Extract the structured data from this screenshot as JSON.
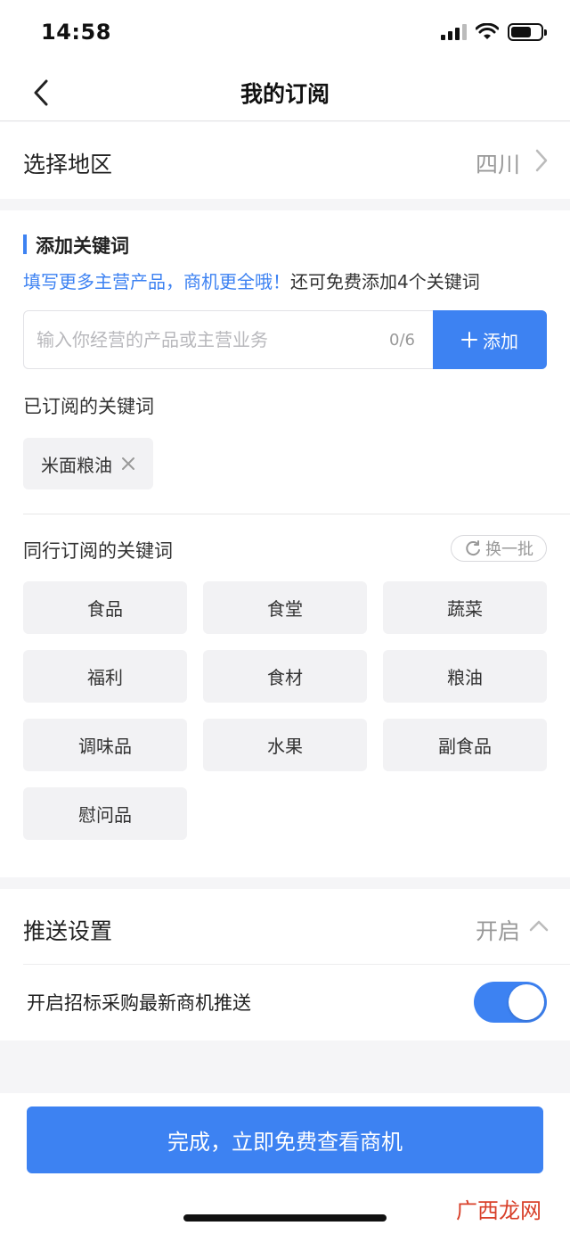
{
  "status_bar": {
    "time": "14:58"
  },
  "nav": {
    "title": "我的订阅"
  },
  "region": {
    "label": "选择地区",
    "value": "四川"
  },
  "keywords": {
    "section_title": "添加关键词",
    "hint_blue": "填写更多主营产品，商机更全哦！",
    "hint_dark": "还可免费添加4个关键词",
    "input_placeholder": "输入你经营的产品或主营业务",
    "counter": "0/6",
    "add_button": "添加",
    "subscribed_label": "已订阅的关键词",
    "subscribed": [
      "米面粮油"
    ],
    "peer_label": "同行订阅的关键词",
    "refresh_label": "换一批",
    "peer_keywords": [
      "食品",
      "食堂",
      "蔬菜",
      "福利",
      "食材",
      "粮油",
      "调味品",
      "水果",
      "副食品",
      "慰问品"
    ]
  },
  "push": {
    "label": "推送设置",
    "status": "开启",
    "item_label": "开启招标采购最新商机推送",
    "enabled": true
  },
  "bottom": {
    "done_button": "完成，立即免费查看商机",
    "watermark": "广西龙网"
  },
  "colors": {
    "accent": "#3d82f2",
    "watermark": "#d8402a"
  },
  "icons": [
    "back-arrow-icon",
    "chevron-right-icon",
    "plus-icon",
    "close-icon",
    "refresh-icon",
    "chevron-up-icon",
    "signal-icon",
    "wifi-icon",
    "battery-icon"
  ]
}
